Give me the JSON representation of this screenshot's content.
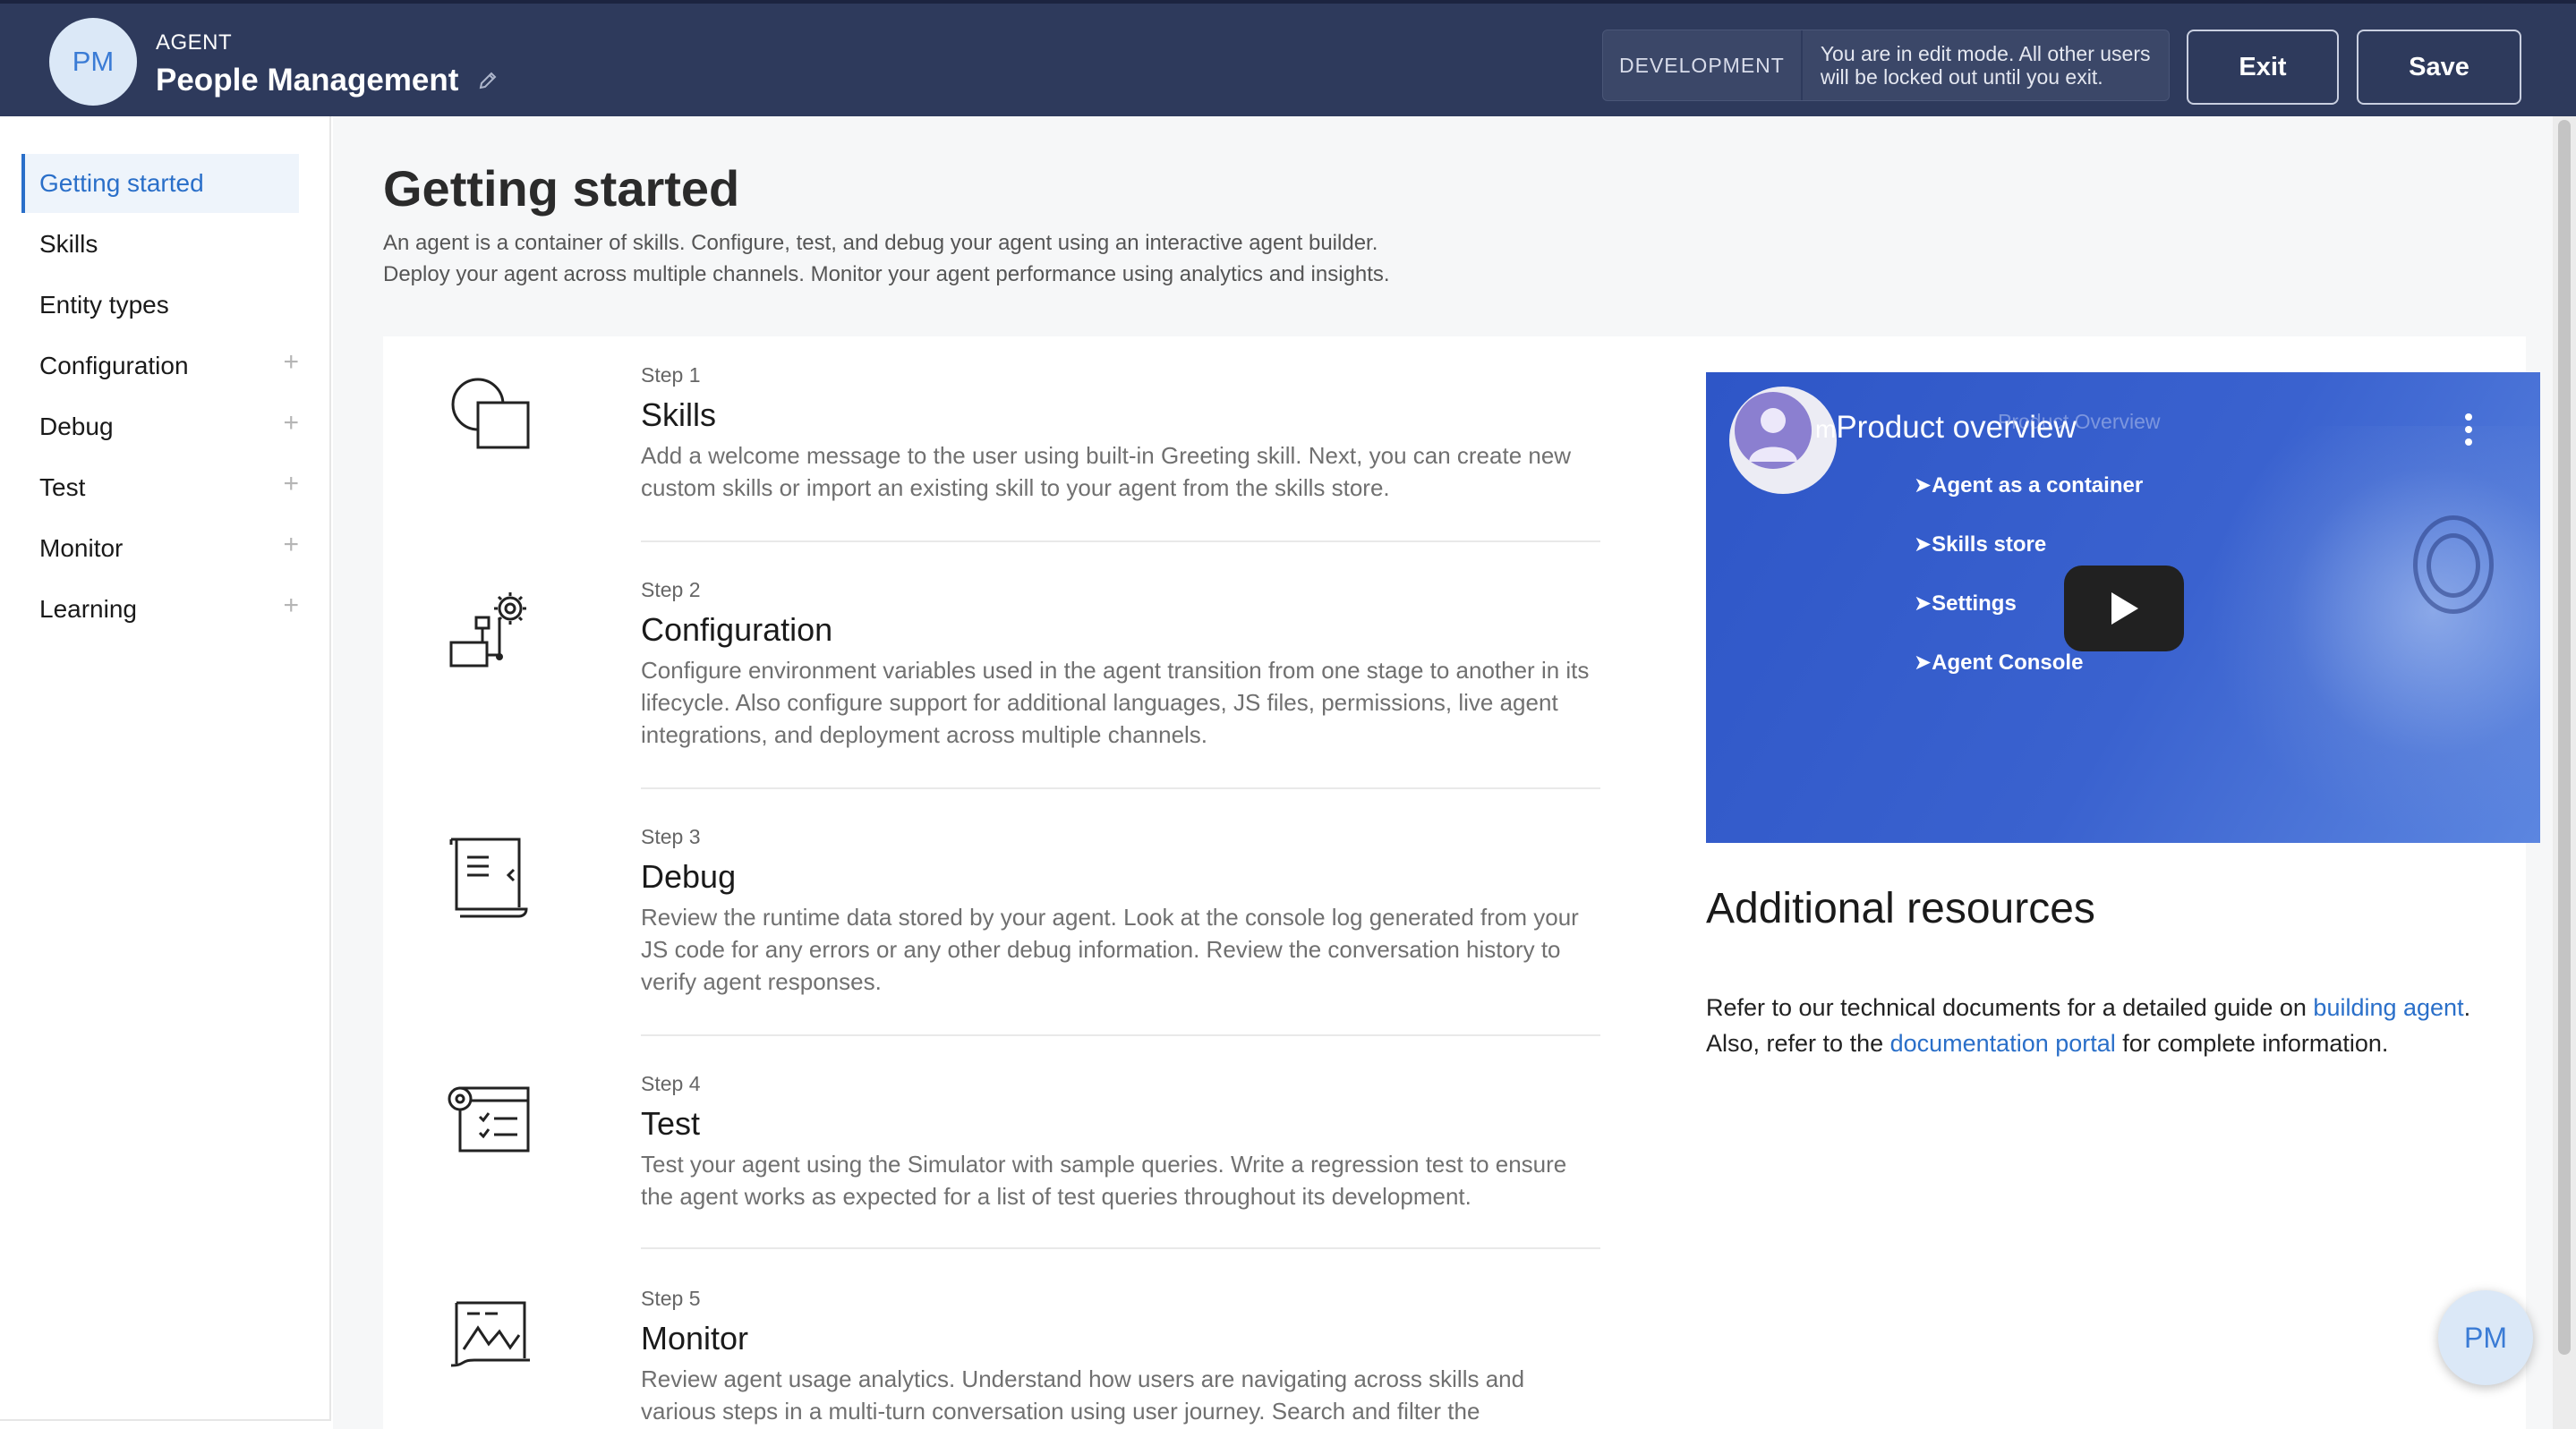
{
  "header": {
    "avatar_initials": "PM",
    "agent_tag": "AGENT",
    "agent_name": "People Management",
    "env_label": "DEVELOPMENT",
    "edit_message": "You are in edit mode. All other users will be locked out until you exit.",
    "exit_label": "Exit",
    "save_label": "Save"
  },
  "sidebar": {
    "items": [
      {
        "label": "Getting started",
        "expandable": false,
        "active": true
      },
      {
        "label": "Skills",
        "expandable": false
      },
      {
        "label": "Entity types",
        "expandable": false
      },
      {
        "label": "Configuration",
        "expandable": true
      },
      {
        "label": "Debug",
        "expandable": true
      },
      {
        "label": "Test",
        "expandable": true
      },
      {
        "label": "Monitor",
        "expandable": true
      },
      {
        "label": "Learning",
        "expandable": true
      }
    ],
    "expand_glyph": "+"
  },
  "main": {
    "title": "Getting started",
    "description_line1": "An agent is a container of skills. Configure, test, and debug your agent using an interactive agent builder.",
    "description_line2": "Deploy your agent across multiple channels. Monitor your agent performance using analytics and insights.",
    "steps": [
      {
        "step": "Step 1",
        "title": "Skills",
        "icon": "skills-shapes-icon",
        "body": "Add a welcome message to the user using built-in Greeting skill. Next, you can create new custom skills or import an existing skill to your agent from the skills store."
      },
      {
        "step": "Step 2",
        "title": "Configuration",
        "icon": "configuration-gear-flow-icon",
        "body": "Configure environment variables used in the agent transition from one stage to another in its lifecycle. Also configure support for additional languages, JS files, permissions, live agent integrations, and deployment across multiple channels."
      },
      {
        "step": "Step 3",
        "title": "Debug",
        "icon": "debug-scroll-code-icon",
        "body": "Review the runtime data stored by your agent. Look at the console log generated from your JS code for any errors or any other debug information. Review the conversation history to verify agent responses."
      },
      {
        "step": "Step 4",
        "title": "Test",
        "icon": "test-checklist-gear-icon",
        "body": "Test your agent using the Simulator with sample queries. Write a regression test to ensure the agent works as expected for a list of test queries throughout its development."
      },
      {
        "step": "Step 5",
        "title": "Monitor",
        "icon": "monitor-chart-icon",
        "body": "Review agent usage analytics. Understand how users are navigating across skills and various steps in a multi-turn conversation using user journey. Search and filter the conversation"
      }
    ]
  },
  "video": {
    "title": "Product overview",
    "ghost_title": "Product Overview",
    "channel_mark": "m",
    "bullets": [
      "➤Agent as a container",
      "➤Skills store",
      "➤Settings",
      "➤Agent Console"
    ]
  },
  "resources": {
    "title": "Additional resources",
    "text_1": "Refer to our technical documents for a detailed guide on ",
    "link_1": "building agent",
    "text_2": ".",
    "text_3": "Also, refer to the ",
    "link_2": "documentation portal",
    "text_4": " for complete information."
  },
  "fab": {
    "initials": "PM"
  },
  "colors": {
    "header_bg": "#2e3a5c",
    "accent": "#2a6fc9",
    "video_bg": "#3a62cf"
  }
}
